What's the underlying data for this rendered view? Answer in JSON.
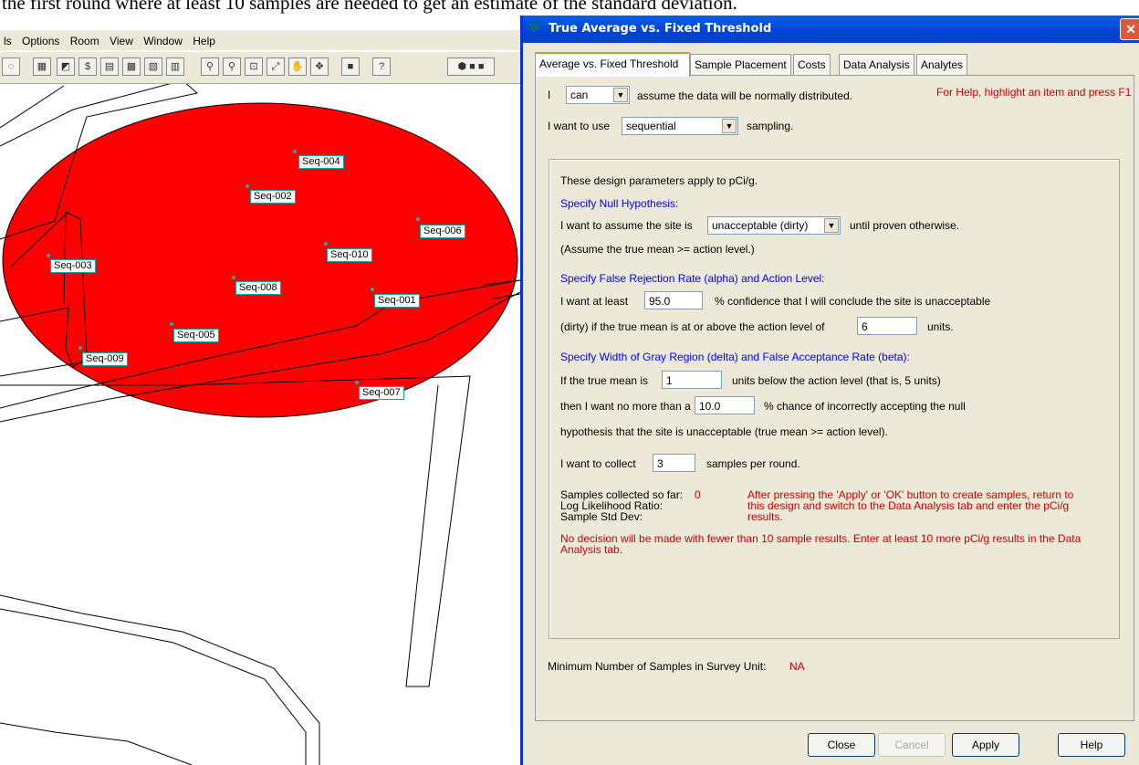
{
  "doc_text": "the first round where at least 10 samples are needed to get an estimate of the standard deviation.",
  "app": {
    "menu": [
      "ls",
      "Options",
      "Room",
      "View",
      "Window",
      "Help"
    ],
    "map_labels": [
      "Seq-004",
      "Seq-002",
      "Seq-006",
      "Seq-010",
      "Seq-003",
      "Seq-008",
      "Seq-001",
      "Seq-005",
      "Seq-009",
      "Seq-007"
    ]
  },
  "dialog": {
    "title": "True Average vs. Fixed Threshold",
    "close_glyph": "✕",
    "tabs": [
      "Average vs. Fixed Threshold",
      "Sample Placement",
      "Costs",
      "Data Analysis",
      "Analytes"
    ],
    "i_label": "I",
    "assume_value": "can",
    "assume_text": "assume the data will be normally distributed.",
    "help_hint": "For Help, highlight an item and press F1",
    "use_label": "I want to use",
    "sampling_value": "sequential",
    "sampling_text": "sampling.",
    "params_apply": "These design parameters apply to pCi/g.",
    "null_heading": "Specify Null Hypothesis:",
    "assume_site_label": "I want to assume the site is",
    "site_value": "unacceptable (dirty)",
    "until_text": "until proven otherwise.",
    "assume_mean": "(Assume the true mean >= action level.)",
    "alpha_heading": "Specify False Rejection Rate (alpha) and Action Level:",
    "at_least_label": "I want at least",
    "confidence_value": "95.0",
    "confidence_text": "% confidence that I will conclude the site is unacceptable",
    "dirty_text": "(dirty) if the true mean is at or above the action level of",
    "action_value": "6",
    "units_text": "units.",
    "delta_heading": "Specify Width of Gray Region (delta) and False Acceptance Rate (beta):",
    "true_mean_label": "If the true mean is",
    "delta_value": "1",
    "below_text": "units below the action level (that is, 5 units)",
    "no_more_label": "then I want no more than a",
    "beta_value": "10.0",
    "chance_text": "% chance of incorrectly accepting the null",
    "hypothesis_text": "hypothesis that the site is unacceptable (true mean >= action level).",
    "collect_label": "I want to collect",
    "collect_value": "3",
    "per_round_text": "samples per round.",
    "collected_label": "Samples collected so far:",
    "collected_value": "0",
    "llr_label": "Log Likelihood Ratio:",
    "std_label": "Sample Std Dev:",
    "after_msg_1": "After pressing the 'Apply' or 'OK' button to create samples, return to",
    "after_msg_2": "this design and switch to the Data Analysis tab and enter the pCi/g",
    "after_msg_3": "results.",
    "decision_msg_1": "No decision will be made with fewer than 10 sample results.  Enter at least 10 more pCi/g results in the Data",
    "decision_msg_2": "Analysis tab.",
    "min_label": "Minimum Number of Samples in Survey Unit:",
    "min_value": "NA",
    "buttons": {
      "close": "Close",
      "cancel": "Cancel",
      "apply": "Apply",
      "help": "Help"
    },
    "dropdown_arrow": "▼"
  }
}
